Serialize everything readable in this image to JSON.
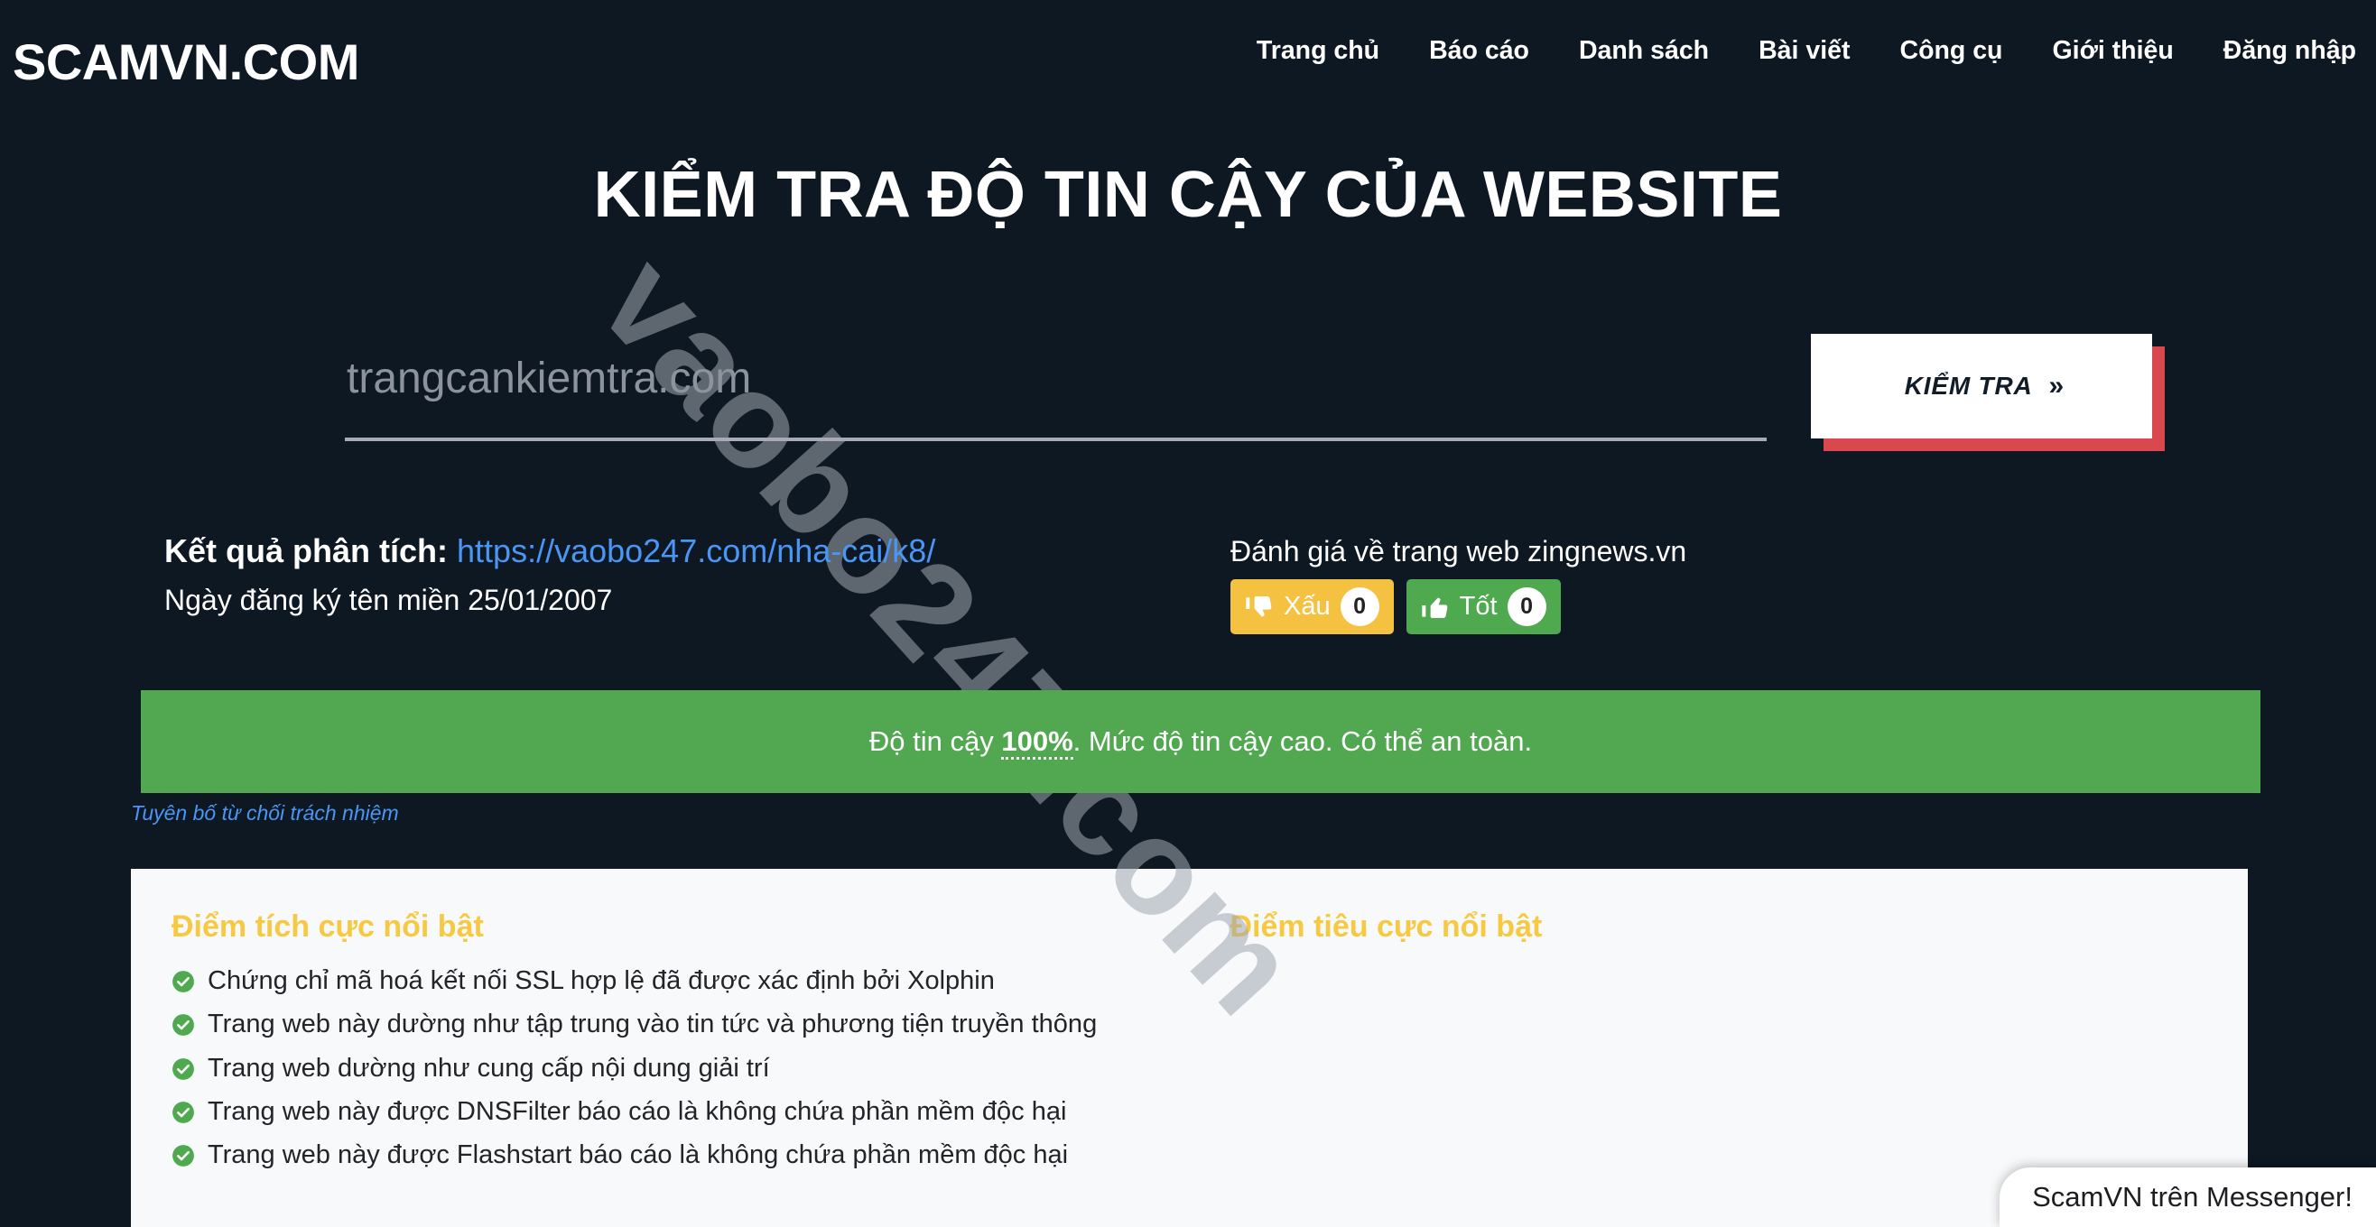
{
  "header": {
    "brand": "SCAMVN.COM",
    "nav": [
      {
        "label": "Trang chủ",
        "name": "nav-item-home"
      },
      {
        "label": "Báo cáo",
        "name": "nav-item-reports"
      },
      {
        "label": "Danh sách",
        "name": "nav-item-list"
      },
      {
        "label": "Bài viết",
        "name": "nav-item-articles"
      },
      {
        "label": "Công cụ",
        "name": "nav-item-tools"
      },
      {
        "label": "Giới thiệu",
        "name": "nav-item-about"
      },
      {
        "label": "Đăng nhập",
        "name": "nav-item-login"
      }
    ]
  },
  "hero": {
    "title": "KIỂM TRA ĐỘ TIN CẬY CỦA WEBSITE"
  },
  "search": {
    "value": "",
    "placeholder": "trangcankiemtra.com",
    "button_label": "KIỂM TRA",
    "button_chevron": "»"
  },
  "result": {
    "analysis_label": "Kết quả phân tích:",
    "analysis_url": "https://vaobo247.com/nha-cai/k8/",
    "domain_date": "Ngày đăng ký tên miền 25/01/2007"
  },
  "rating": {
    "title": "Đánh giá về trang web zingnews.vn",
    "bad_label": "Xấu",
    "bad_count": "0",
    "good_label": "Tốt",
    "good_count": "0"
  },
  "trust": {
    "prefix": "Độ tin cậy ",
    "score": "100%",
    "suffix": ". Mức độ tin cậy cao. Có thể an toàn."
  },
  "disclaimer": {
    "label": "Tuyên bố từ chối trách nhiệm"
  },
  "findings": {
    "positive_heading": "Điểm tích cực nổi bật",
    "negative_heading": "Điểm tiêu cực nổi bật",
    "positive_items": [
      "Chứng chỉ mã hoá kết nối SSL hợp lệ đã được xác định bởi Xolphin",
      "Trang web này dường như tập trung vào tin tức và phương tiện truyền thông",
      "Trang web dường như cung cấp nội dung giải trí",
      "Trang web này được DNSFilter báo cáo là không chứa phần mềm độc hại",
      "Trang web này được Flashstart báo cáo là không chứa phần mềm độc hại"
    ],
    "negative_items": []
  },
  "watermark": {
    "text": "vaobo247.com"
  },
  "messenger": {
    "label": "ScamVN trên Messenger!"
  },
  "colors": {
    "page_background": "#0e1823",
    "accent_red": "#d9484f",
    "trust_green": "#52a851",
    "vote_bad_yellow": "#f5c141",
    "vote_good_green": "#4fa94f",
    "heading_gold": "#f7c943",
    "link_blue": "#4a96f5",
    "card_background": "#f7f9fa"
  }
}
